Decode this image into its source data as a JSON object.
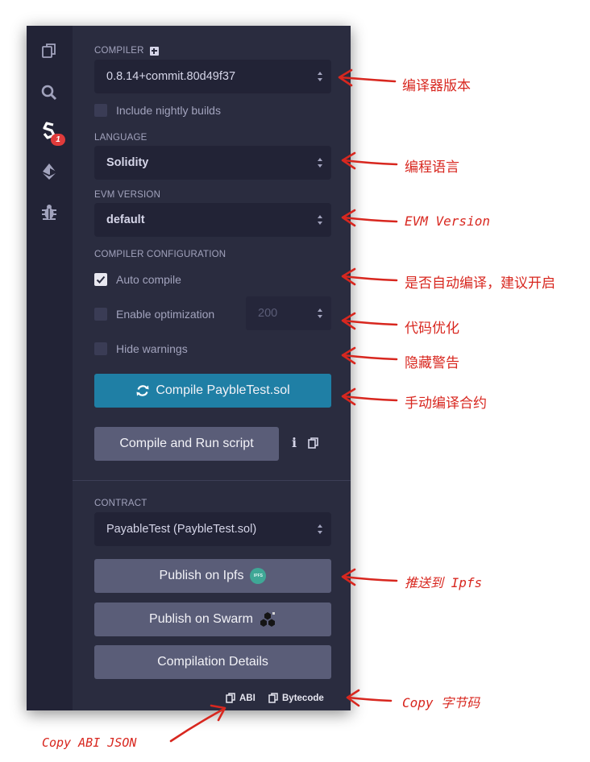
{
  "compiler": {
    "section_label": "COMPILER",
    "version": "0.8.14+commit.80d49f37",
    "include_nightly": "Include nightly builds"
  },
  "language": {
    "section_label": "LANGUAGE",
    "value": "Solidity"
  },
  "evm": {
    "section_label": "EVM VERSION",
    "value": "default"
  },
  "config": {
    "section_label": "COMPILER CONFIGURATION",
    "auto_compile": "Auto compile",
    "auto_compile_checked": true,
    "enable_optimization": "Enable optimization",
    "runs": "200",
    "hide_warnings": "Hide warnings"
  },
  "actions": {
    "compile_button": "Compile PaybleTest.sol",
    "compile_run_button": "Compile and Run script"
  },
  "contract": {
    "section_label": "CONTRACT",
    "value": "PayableTest (PaybleTest.sol)",
    "publish_ipfs": "Publish on Ipfs",
    "ipfs_badge": "IPFS",
    "publish_swarm": "Publish on Swarm",
    "details": "Compilation Details",
    "copy_abi": "ABI",
    "copy_bytecode": "Bytecode"
  },
  "sidebar": {
    "badge_count": "1",
    "icons": [
      "file-explorer-icon",
      "search-icon",
      "solidity-compiler-icon",
      "deploy-run-icon",
      "debugger-icon"
    ]
  },
  "annotations": {
    "compiler_version": "编译器版本",
    "language": "编程语言",
    "evm_version": "EVM Version",
    "auto_compile": "是否自动编译，建议开启",
    "optimization": "代码优化",
    "hide_warnings": "隐藏警告",
    "manual_compile": "手动编译合约",
    "push_ipfs": "推送到 Ipfs",
    "copy_bytecode": "Copy 字节码",
    "copy_abi_json": "Copy ABI JSON"
  },
  "colors": {
    "panel_bg": "#2a2c3f",
    "iconbar_bg": "#222336",
    "primary_button": "#1f7fa5",
    "secondary_button": "#5a5d78",
    "annotation_red": "#d8271f",
    "badge_red": "#e03b3b"
  }
}
